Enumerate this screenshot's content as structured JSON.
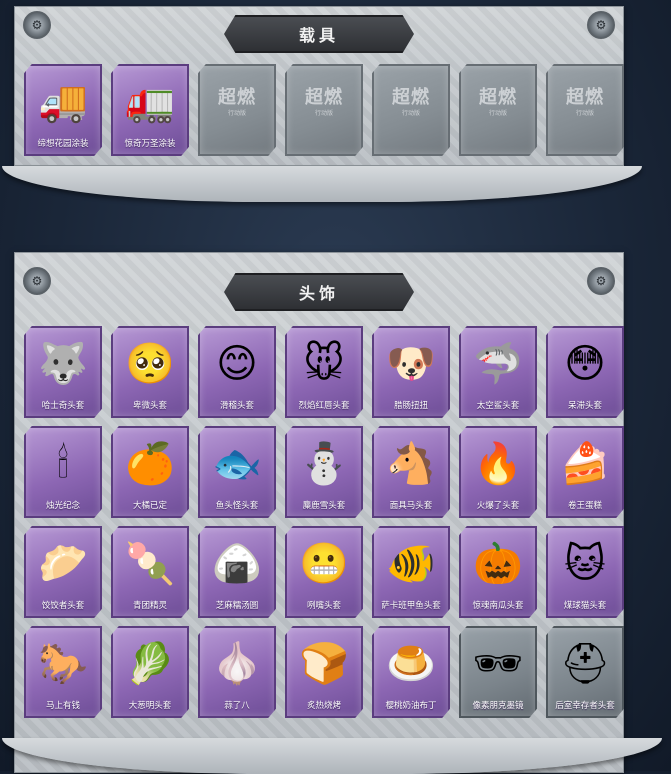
{
  "vehicles": {
    "title": "载具",
    "items": [
      {
        "label": "缔想花园涂装",
        "icon": "ice-cream-truck-icon",
        "glyph": "🚚"
      },
      {
        "label": "惊奇万圣涂装",
        "icon": "halloween-truck-icon",
        "glyph": "🚛"
      }
    ],
    "locked_items": [
      {
        "text": "超燃",
        "sub": "行动版"
      },
      {
        "text": "超燃",
        "sub": "行动版"
      },
      {
        "text": "超燃",
        "sub": "行动版"
      },
      {
        "text": "超燃",
        "sub": "行动版"
      },
      {
        "text": "超燃",
        "sub": "行动版"
      }
    ]
  },
  "headwear": {
    "title": "头饰",
    "items": [
      {
        "label": "哈士奇头套",
        "icon": "husky-mask-icon",
        "glyph": "🐺",
        "rarity": "purple"
      },
      {
        "label": "卑微头套",
        "icon": "humble-face-mask-icon",
        "glyph": "🥺",
        "rarity": "purple"
      },
      {
        "label": "滑稽头套",
        "icon": "funny-face-mask-icon",
        "glyph": "😊",
        "rarity": "purple"
      },
      {
        "label": "烈焰红唇头套",
        "icon": "red-lips-pikachu-mask-icon",
        "glyph": "🐭",
        "rarity": "purple"
      },
      {
        "label": "腊肠扭扭",
        "icon": "dachshund-mask-icon",
        "glyph": "🐶",
        "rarity": "purple"
      },
      {
        "label": "太空鲨头套",
        "icon": "space-shark-mask-icon",
        "glyph": "🦈",
        "rarity": "purple"
      },
      {
        "label": "呆滞头套",
        "icon": "dazed-face-mask-icon",
        "glyph": "😳",
        "rarity": "purple"
      },
      {
        "label": "烛光纪念",
        "icon": "candle-mask-icon",
        "glyph": "🕯",
        "rarity": "purple"
      },
      {
        "label": "大橘已定",
        "icon": "orange-mask-icon",
        "glyph": "🍊",
        "rarity": "purple"
      },
      {
        "label": "鱼头怪头套",
        "icon": "fish-head-mask-icon",
        "glyph": "🐟",
        "rarity": "purple"
      },
      {
        "label": "麋鹿雪头套",
        "icon": "snowman-elk-mask-icon",
        "glyph": "⛄",
        "rarity": "purple"
      },
      {
        "label": "面具马头套",
        "icon": "horse-mask-icon",
        "glyph": "🐴",
        "rarity": "purple"
      },
      {
        "label": "火爆了头套",
        "icon": "fire-spirit-mask-icon",
        "glyph": "🔥",
        "rarity": "purple"
      },
      {
        "label": "卷王蛋糕",
        "icon": "roll-cake-mask-icon",
        "glyph": "🍰",
        "rarity": "purple"
      },
      {
        "label": "饺饺者头套",
        "icon": "dumpling-mask-icon",
        "glyph": "🥟",
        "rarity": "purple"
      },
      {
        "label": "青团精灵",
        "icon": "green-rice-ball-mask-icon",
        "glyph": "🍡",
        "rarity": "purple"
      },
      {
        "label": "芝麻糯汤圆",
        "icon": "sesame-dumpling-mask-icon",
        "glyph": "🍙",
        "rarity": "purple"
      },
      {
        "label": "咧嘴头套",
        "icon": "grinning-face-mask-icon",
        "glyph": "😬",
        "rarity": "purple"
      },
      {
        "label": "萨卡班甲鱼头套",
        "icon": "sacabambaspis-mask-icon",
        "glyph": "🐠",
        "rarity": "purple"
      },
      {
        "label": "惊魂南瓜头套",
        "icon": "pumpkin-mask-icon",
        "glyph": "🎃",
        "rarity": "purple"
      },
      {
        "label": "煤球猫头套",
        "icon": "coal-cat-mask-icon",
        "glyph": "🐱",
        "rarity": "purple"
      },
      {
        "label": "马上有钱",
        "icon": "rich-horse-mask-icon",
        "glyph": "🐎",
        "rarity": "purple"
      },
      {
        "label": "大葱明头套",
        "icon": "green-onion-mask-icon",
        "glyph": "🥬",
        "rarity": "purple"
      },
      {
        "label": "蒜了八",
        "icon": "garlic-mask-icon",
        "glyph": "🧄",
        "rarity": "purple"
      },
      {
        "label": "炙热烧烤",
        "icon": "bbq-toast-mask-icon",
        "glyph": "🍞",
        "rarity": "purple"
      },
      {
        "label": "樱桃奶油布丁",
        "icon": "cherry-pudding-mask-icon",
        "glyph": "🍮",
        "rarity": "purple"
      },
      {
        "label": "像素朋克墨镜",
        "icon": "pixel-sunglasses-icon",
        "glyph": "🕶",
        "rarity": "grey"
      },
      {
        "label": "后室幸存者头套",
        "icon": "gas-mask-helmet-icon",
        "glyph": "⛑",
        "rarity": "grey"
      }
    ]
  }
}
